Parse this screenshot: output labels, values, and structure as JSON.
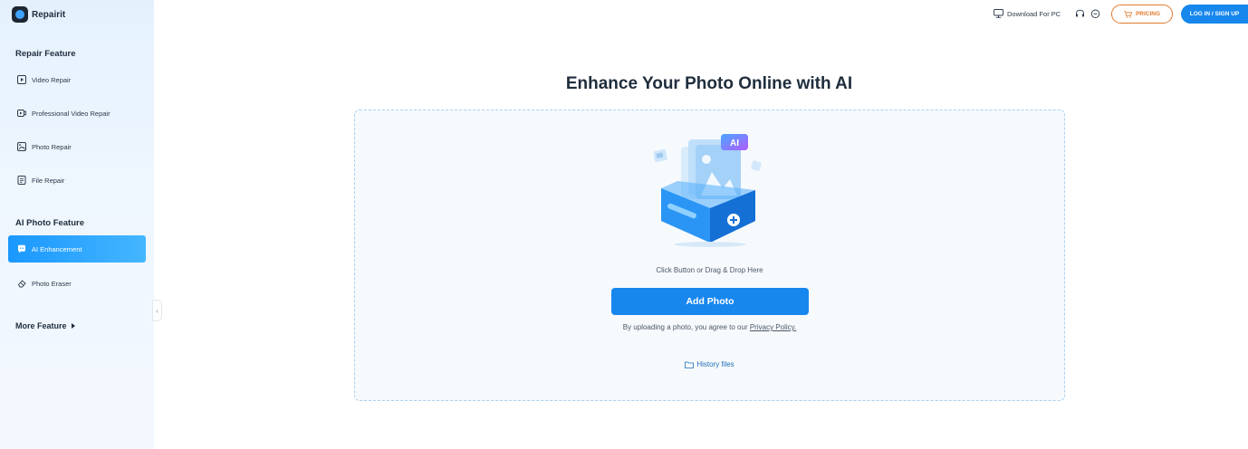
{
  "app": {
    "name": "Repairit"
  },
  "sidebar": {
    "section_repair": "Repair Feature",
    "repair_items": [
      {
        "label": "Video Repair",
        "icon": "play-icon"
      },
      {
        "label": "Professional Video Repair",
        "icon": "video-camera-icon"
      },
      {
        "label": "Photo Repair",
        "icon": "image-icon"
      },
      {
        "label": "File Repair",
        "icon": "document-icon"
      }
    ],
    "section_ai": "AI Photo Feature",
    "ai_items": [
      {
        "label": "AI Enhancement",
        "icon": "ai-chat-icon",
        "active": true
      },
      {
        "label": "Photo Eraser",
        "icon": "eraser-icon",
        "active": false
      }
    ],
    "more_label": "More Feature",
    "collapse_glyph": "‹"
  },
  "topbar": {
    "download_label": "Download For PC",
    "pricing_label": "PRICING",
    "login_label": "LOG IN / SIGN UP"
  },
  "main": {
    "title": "Enhance Your Photo Online with AI",
    "hint": "Click Button or Drag & Drop Here",
    "add_button": "Add Photo",
    "agree_prefix": "By uploading a photo, you agree to our ",
    "privacy_link": "Privacy Policy.",
    "history_label": "History files",
    "ai_badge": "AI"
  },
  "colors": {
    "accent": "#1787ee",
    "pricing": "#e07b2f",
    "sidebar_bg": "#e4f1fd"
  }
}
